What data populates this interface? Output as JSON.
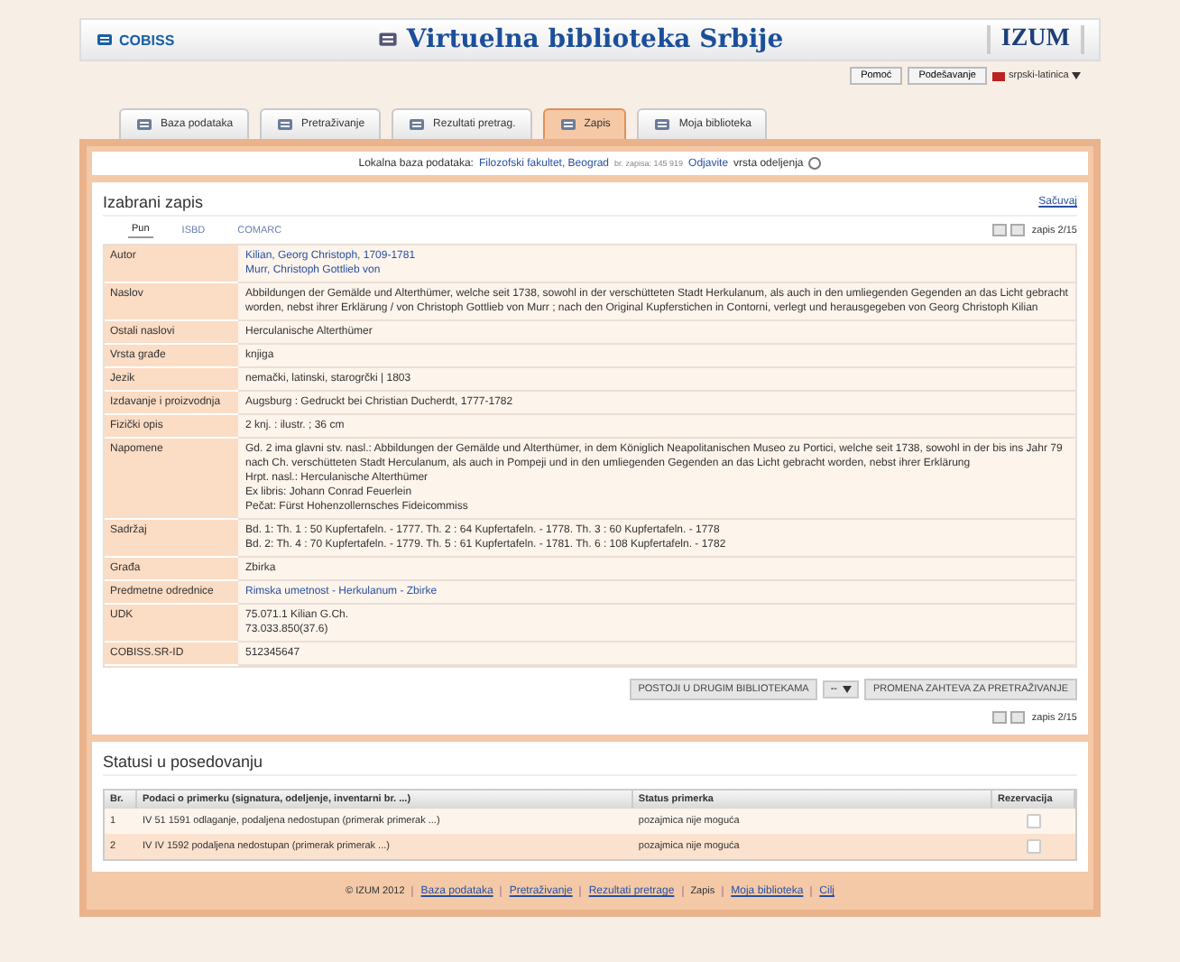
{
  "header": {
    "logo": "COBISS",
    "title": "Virtuelna biblioteka Srbije",
    "brand": "IZUM",
    "buttons": [
      "Pomoć",
      "Podešavanje"
    ],
    "language": "srpski-latinica"
  },
  "tabs": [
    {
      "label": "Baza podataka",
      "selected": false
    },
    {
      "label": "Pretraživanje",
      "selected": false
    },
    {
      "label": "Rezultati pretrag.",
      "selected": false
    },
    {
      "label": "Zapis",
      "selected": true
    },
    {
      "label": "Moja biblioteka",
      "selected": false
    }
  ],
  "location": {
    "label": "Lokalna baza podataka:",
    "library": "Filozofski fakultet, Beograd",
    "note": "br. zapisa: 145 919",
    "link": "Odjavite",
    "text": "vrsta odeljenja"
  },
  "record": {
    "title": "Izabrani zapis",
    "action": "Sačuvaj",
    "views": [
      {
        "label": "Pun",
        "selected": true
      },
      {
        "label": "ISBD",
        "selected": false
      },
      {
        "label": "COMARC",
        "selected": false
      }
    ],
    "pager_top": "zapis 2/15",
    "pager_bottom": "zapis 2/15",
    "fields": [
      {
        "label": "Autor",
        "kind": "link",
        "lines": [
          "Kilian, Georg Christoph, 1709-1781",
          "Murr, Christoph Gottlieb von"
        ]
      },
      {
        "label": "Naslov",
        "kind": "text",
        "lines": [
          "Abbildungen der Gemälde und Alterthümer, welche seit 1738, sowohl in der verschütteten Stadt Herkulanum, als auch in den umliegenden Gegenden an das Licht gebracht worden, nebst ihrer Erklärung / von Christoph Gottlieb von Murr ; nach den Original Kupferstichen in Contorni, verlegt und herausgegeben von Georg Christoph Kilian"
        ]
      },
      {
        "label": "Ostali naslovi",
        "kind": "text",
        "lines": [
          "Herculanische Alterthümer"
        ]
      },
      {
        "label": "Vrsta građe",
        "kind": "text",
        "lines": [
          "knjiga"
        ]
      },
      {
        "label": "Jezik",
        "kind": "text",
        "lines": [
          "nemački, latinski, starogrčki | 1803"
        ]
      },
      {
        "label": "Izdavanje i proizvodnja",
        "kind": "text",
        "lines": [
          "Augsburg : Gedruckt bei Christian Ducherdt, 1777-1782"
        ]
      },
      {
        "label": "Fizički opis",
        "kind": "text",
        "lines": [
          "2 knj. : ilustr. ; 36 cm"
        ]
      },
      {
        "label": "Napomene",
        "kind": "text",
        "lines": [
          "Gd. 2 ima glavni stv. nasl.: Abbildungen der Gemälde und Alterthümer, in dem Königlich Neapolitanischen Museo zu Portici, welche seit 1738, sowohl in der bis ins Jahr 79 nach Ch. verschütteten Stadt Herculanum, als auch in Pompeji und in den umliegenden Gegenden an das Licht gebracht worden, nebst ihrer Erklärung",
          "Hrpt. nasl.: Herculanische Alterthümer",
          "Ex libris: Johann Conrad Feuerlein",
          "Pečat: Fürst Hohenzollernsches Fideicommiss"
        ]
      },
      {
        "label": "Sadržaj",
        "kind": "text",
        "lines": [
          "Bd. 1: Th. 1 : 50 Kupfertafeln. - 1777. Th. 2 : 64 Kupfertafeln. - 1778. Th. 3 : 60 Kupfertafeln. - 1778",
          "Bd. 2: Th. 4 : 70 Kupfertafeln. - 1779. Th. 5 : 61 Kupfertafeln. - 1781. Th. 6 : 108 Kupfertafeln. - 1782"
        ]
      },
      {
        "label": "Građa",
        "kind": "text",
        "lines": [
          "Zbirka"
        ]
      },
      {
        "label": "Predmetne odrednice",
        "kind": "link",
        "lines": [
          "Rimska umetnost - Herkulanum - Zbirke"
        ]
      },
      {
        "label": "UDK",
        "kind": "text",
        "lines": [
          "75.071.1 Kilian G.Ch.",
          "73.033.850(37.6)"
        ]
      },
      {
        "label": "COBISS.SR-ID",
        "kind": "text",
        "lines": [
          "512345647"
        ]
      }
    ],
    "buttons": [
      "POSTOJI U DRUGIM BIBLIOTEKAMA",
      "PROMENA ZAHTEVA ZA PRETRAŽIVANJE"
    ],
    "select": "--"
  },
  "holdings": {
    "title": "Statusi u posedovanju",
    "columns": [
      "Br.",
      "Podaci o primerku (signatura, odeljenje, inventarni br. ...)",
      "Status primerka",
      "Rezervacija"
    ],
    "rows": [
      {
        "no": "1",
        "item": "IV 51 1591 odlaganje, podaljena nedostupan (primerak primerak ...)",
        "status": "pozajmica nije moguća",
        "checked": false
      },
      {
        "no": "2",
        "item": "IV IV 1592 podaljena nedostupan (primerak primerak ...)",
        "status": "pozajmica nije moguća",
        "checked": false
      }
    ]
  },
  "footer": [
    {
      "label": "© IZUM 2012",
      "selected": true
    },
    {
      "label": "Baza podataka",
      "selected": false
    },
    {
      "label": "Pretraživanje",
      "selected": false
    },
    {
      "label": "Rezultati pretrage",
      "selected": false
    },
    {
      "label": "Zapis",
      "selected": true
    },
    {
      "label": "Moja biblioteka",
      "selected": false
    },
    {
      "label": "Cilj",
      "selected": false
    }
  ]
}
